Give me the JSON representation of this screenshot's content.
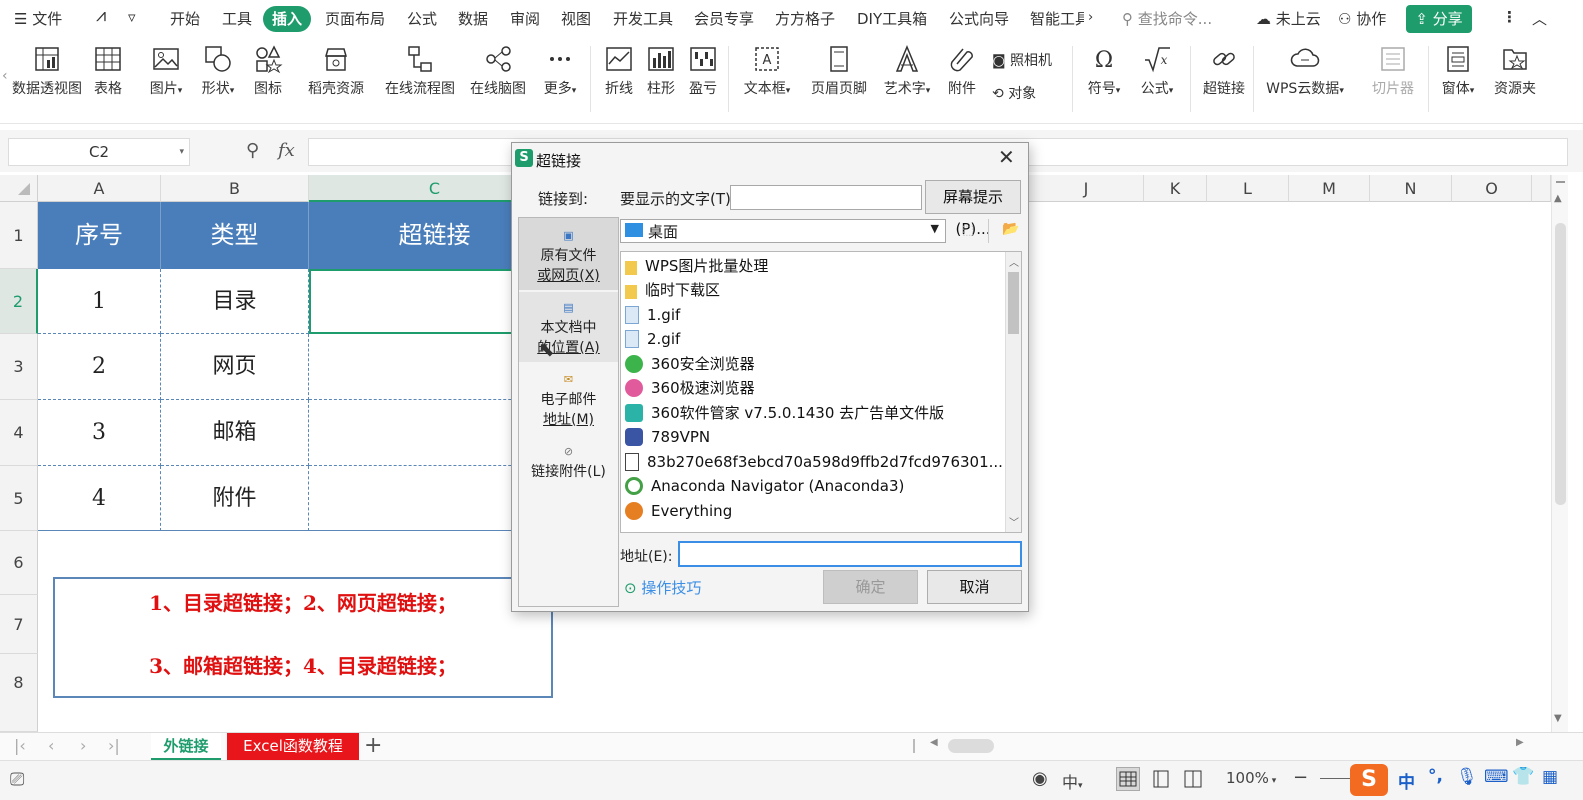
{
  "menubar": {
    "hamburger_label": "文件",
    "items": [
      "开始",
      "工具",
      "插入",
      "页面布局",
      "公式",
      "数据",
      "审阅",
      "视图",
      "开发工具",
      "会员专享",
      "方方格子",
      "DIY工具箱",
      "公式向导",
      "智能工具"
    ],
    "active_item": "插入",
    "search_placeholder": "查找命令...",
    "cloud_label": "未上云",
    "collab_label": "协作",
    "share_label": "分享"
  },
  "ribbon": {
    "buttons": [
      "数据透视图",
      "表格",
      "图片",
      "形状",
      "图标",
      "稻壳资源",
      "在线流程图",
      "在线脑图",
      "更多",
      "折线",
      "柱形",
      "盈亏",
      "文本框",
      "页眉页脚",
      "艺术字",
      "附件",
      "符号",
      "公式",
      "超链接",
      "WPS云数据",
      "切片器",
      "窗体",
      "资源夹"
    ],
    "camera_label": "照相机",
    "object_label": "对象"
  },
  "formula_bar": {
    "cell_ref": "C2",
    "fx_label": "fx"
  },
  "grid": {
    "columns": [
      "A",
      "B",
      "C",
      "J",
      "K",
      "L",
      "M",
      "N",
      "O"
    ],
    "rows": [
      "1",
      "2",
      "3",
      "4",
      "5",
      "6",
      "7",
      "8"
    ],
    "header_row": [
      "序号",
      "类型",
      "超链接"
    ],
    "data_rows": [
      [
        "1",
        "目录"
      ],
      [
        "2",
        "网页"
      ],
      [
        "3",
        "邮箱"
      ],
      [
        "4",
        "附件"
      ]
    ],
    "note_lines": [
      "1、目录超链接；2、网页超链接；",
      "3、邮箱超链接；4、目录超链接；"
    ]
  },
  "sheet_tabs": {
    "tabs": [
      "外链接",
      "Excel函数教程"
    ],
    "active": "外链接",
    "add_label": "+"
  },
  "status_bar": {
    "zoom": "100%",
    "ime_label": "中"
  },
  "dialog": {
    "title": "超链接",
    "link_to_label": "链接到:",
    "display_text_label": "要显示的文字(T):",
    "display_text_value": "",
    "screentip_button": "屏幕提示(P)...",
    "location_value": "桌面",
    "side_items": [
      {
        "line1": "原有文件",
        "line2": "或网页(X)"
      },
      {
        "line1": "本文档中",
        "line2": "的位置(A)"
      },
      {
        "line1": "电子邮件",
        "line2": "地址(M)"
      },
      {
        "line1": "链接附件(L)",
        "line2": ""
      }
    ],
    "files": [
      {
        "name": "WPS图片批量处理",
        "icon": "folder-icon"
      },
      {
        "name": "临时下载区",
        "icon": "folder-icon"
      },
      {
        "name": "1.gif",
        "icon": "gif-file-icon"
      },
      {
        "name": "2.gif",
        "icon": "gif-file-icon"
      },
      {
        "name": "360安全浏览器",
        "icon": "browser-icon"
      },
      {
        "name": "360极速浏览器",
        "icon": "browser-icon"
      },
      {
        "name": "360软件管家 v7.5.0.1430 去广告单文件版",
        "icon": "app-icon"
      },
      {
        "name": "789VPN",
        "icon": "vpn-icon"
      },
      {
        "name": "83b270e68f3ebcd70a598d9ffb2d7fcd976301...",
        "icon": "video-file-icon"
      },
      {
        "name": "Anaconda Navigator (Anaconda3)",
        "icon": "anaconda-icon"
      },
      {
        "name": "Everything",
        "icon": "search-app-icon"
      }
    ],
    "address_label": "地址(E):",
    "address_value": "",
    "tips_label": "操作技巧",
    "ok_button": "确定",
    "cancel_button": "取消"
  },
  "colors": {
    "accent": "#1e9c6c",
    "header_fill": "#4a7ebb",
    "note_text": "#e01010",
    "tab_red": "#e8161b"
  }
}
